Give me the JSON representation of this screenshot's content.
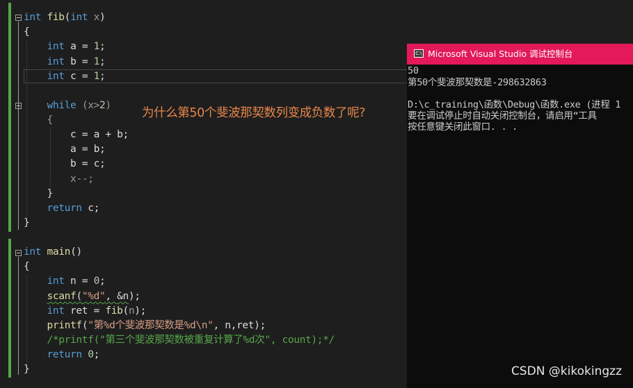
{
  "editor": {
    "lines": {
      "l1": {
        "kw": "int",
        "name": "fib",
        "open": "(",
        "ptype": "int",
        "pname": "x",
        "close": ")"
      },
      "l2": "{",
      "l3": {
        "kw": "int",
        "rest": "a = ",
        "num": "1",
        "end": ";"
      },
      "l4": {
        "kw": "int",
        "rest": "b = ",
        "num": "1",
        "end": ";"
      },
      "l5": {
        "kw": "int",
        "rest": "c = ",
        "num": "1",
        "end": ";"
      },
      "l6": {
        "kw": "while",
        "cond_open": " (",
        "param": "x",
        "op": ">",
        "num": "2",
        "cond_close": ")"
      },
      "l7": "{",
      "l8": "c = a + b;",
      "l9": "a = b;",
      "l10": "b = c;",
      "l11": {
        "param": "x",
        "rest": "--;"
      },
      "l12": "}",
      "l13": {
        "kw": "return",
        "rest": " c;"
      },
      "l14": "}",
      "l15": {
        "kw": "int",
        "name": "main",
        "rest": "()"
      },
      "l16": "{",
      "l17": {
        "kw": "int",
        "rest": " n = ",
        "num": "0",
        "end": ";"
      },
      "l18": {
        "fn": "scanf",
        "open": "(",
        "str": "\"%d\"",
        "mid": ", ",
        "arg": "&n",
        "close": ");"
      },
      "l19": {
        "kw": "int",
        "rest": " ret = ",
        "fn": "fib",
        "open": "(",
        "arg": "n",
        "close": ");"
      },
      "l20": {
        "fn": "printf",
        "open": "(",
        "str_a": "\"第",
        "fmt1": "%d",
        "str_b": "个斐波那契数是",
        "fmt2": "%d\\n",
        "str_c": "\"",
        "close": ", n,ret);"
      },
      "l21": "/*printf(\"第三个斐波那契数被重复计算了%d次\", count);*/",
      "l22": {
        "kw": "return",
        "rest": " ",
        "num": "0",
        "end": ";"
      },
      "l23": "}"
    }
  },
  "question": "为什么第50个斐波那契数列变成负数了呢?",
  "console": {
    "title": "Microsoft Visual Studio 调试控制台",
    "icon_text": "C:\\",
    "lines": [
      "50",
      "第50个斐波那契数是-298632863",
      "",
      "D:\\c_training\\函数\\Debug\\函数.exe (进程 1",
      "要在调试停止时自动关闭控制台，请启用“工具",
      "按任意键关闭此窗口. . ."
    ]
  },
  "watermark": "CSDN @kikokingzz",
  "colors": {
    "keyword": "#569cd6",
    "function": "#dcdcaa",
    "number": "#b5cea8",
    "string": "#d69d85",
    "comment": "#57a64a",
    "title_bar": "#e3195a"
  }
}
